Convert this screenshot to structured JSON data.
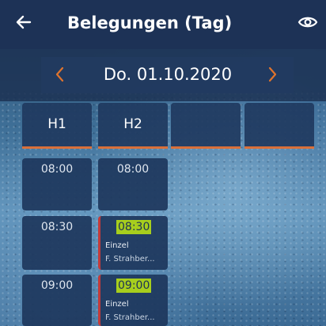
{
  "appbar": {
    "title": "Belegungen (Tag)",
    "back_icon": "arrow-left-icon",
    "view_icon": "eye-icon"
  },
  "datebar": {
    "date": "Do. 01.10.2020",
    "prev_icon": "chevron-left-icon",
    "next_icon": "chevron-right-icon",
    "accent_color": "#e0742d"
  },
  "columns": [
    {
      "label": "H1"
    },
    {
      "label": "H2"
    },
    {
      "label": ""
    },
    {
      "label": ""
    }
  ],
  "slots": {
    "h1_0800": {
      "time": "08:00"
    },
    "h2_0800": {
      "time": "08:00"
    },
    "h1_0830": {
      "time": "08:30"
    },
    "h2_0830": {
      "time": "08:30",
      "type": "Einzel",
      "person": "F. Strahber..."
    },
    "h1_0900": {
      "time": "09:00"
    },
    "h2_0900": {
      "time": "09:00",
      "type": "Einzel",
      "person": "F. Strahber..."
    }
  },
  "colors": {
    "header_bg": "#1d3256",
    "booking_highlight": "#a7ce1d",
    "booking_marker": "#c23b3b"
  }
}
